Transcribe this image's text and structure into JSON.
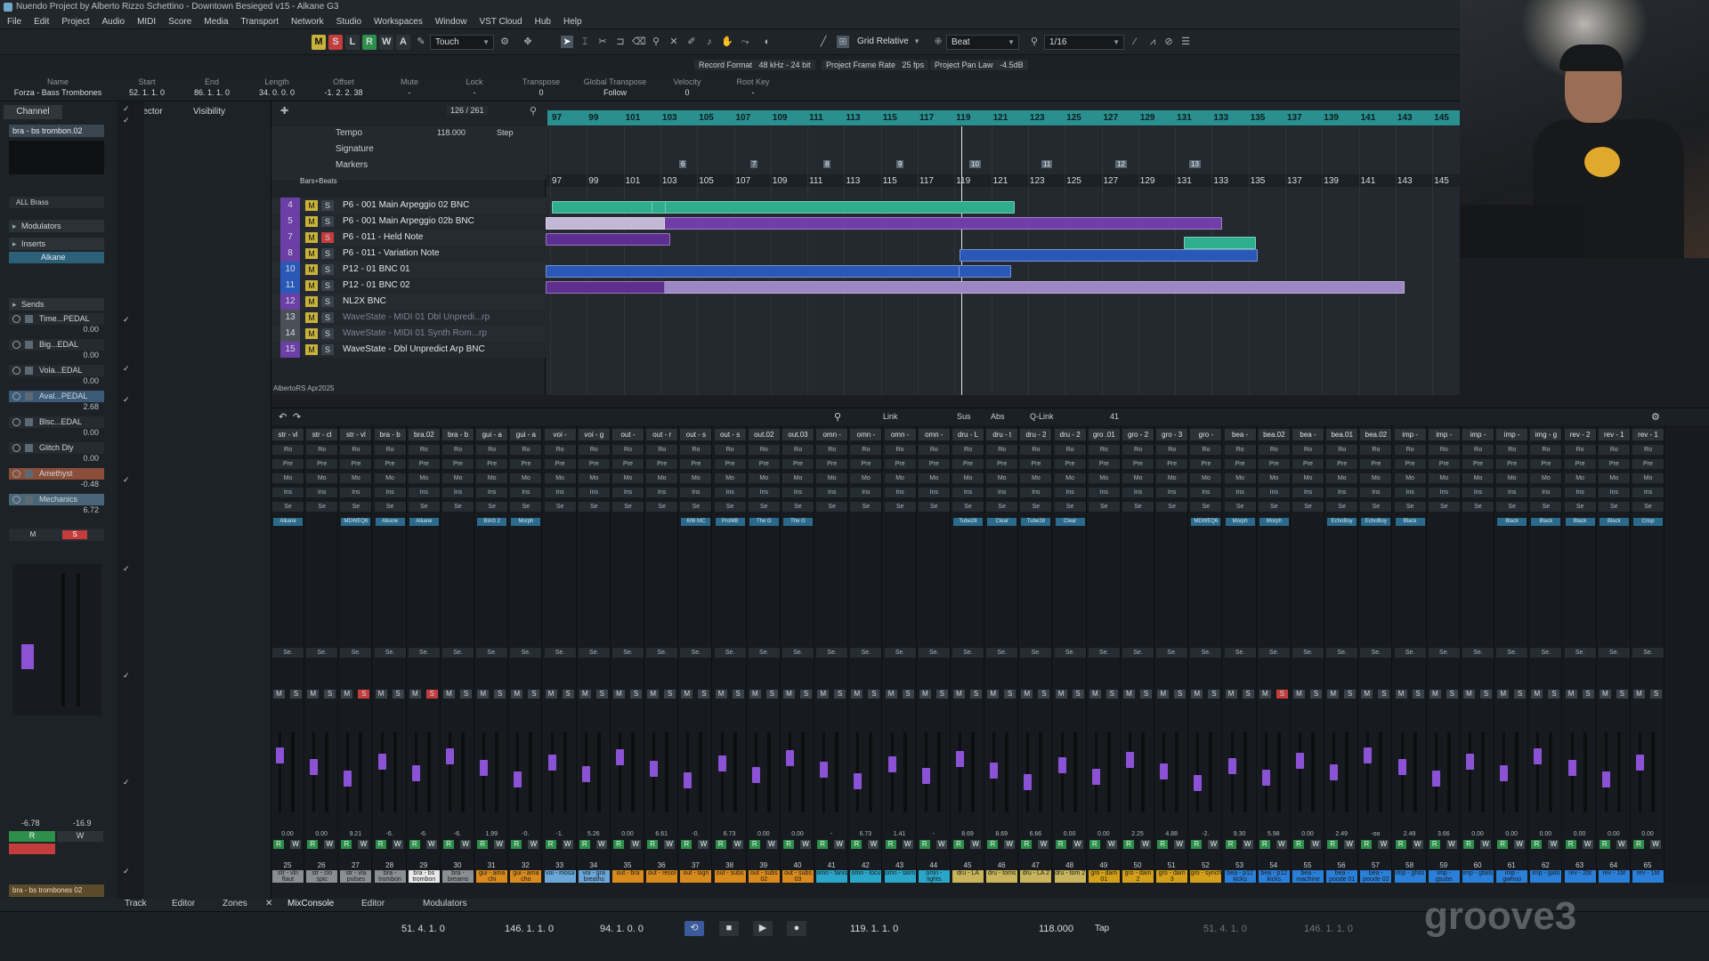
{
  "window": {
    "title": "Nuendo Project by Alberto Rizzo Schettino - Downtown Besieged v15 - Alkane G3"
  },
  "menu": [
    "File",
    "Edit",
    "Project",
    "Audio",
    "MIDI",
    "Score",
    "Media",
    "Transport",
    "Network",
    "Studio",
    "Workspaces",
    "Window",
    "VST Cloud",
    "Hub",
    "Help"
  ],
  "toolbar": {
    "buttons": [
      "M",
      "S",
      "L",
      "R",
      "W",
      "A"
    ],
    "automation_mode": "Touch",
    "grid_mode": "Grid Relative",
    "grid_type": "Beat",
    "quantize": "1/16"
  },
  "status": {
    "record_format_label": "Record Format",
    "record_format": "48 kHz - 24 bit",
    "frame_rate_label": "Project Frame Rate",
    "frame_rate": "25 fps",
    "pan_law_label": "Project Pan Law",
    "pan_law": "-4.5dB"
  },
  "infoline": {
    "labels": [
      "Name",
      "Start",
      "End",
      "Length",
      "Offset",
      "Mute",
      "Lock",
      "Transpose",
      "Global Transpose",
      "Velocity",
      "Root Key"
    ],
    "values": [
      "Forza - Bass Trombones",
      "52. 1. 1. 0",
      "86. 1. 1. 0",
      "34. 0. 0. 0",
      "-1. 2. 2. 38",
      "-",
      "-",
      "0",
      "Follow",
      "0",
      "-"
    ]
  },
  "leftzone": {
    "tabs": [
      "Channel",
      "Inspector",
      "Visibility"
    ],
    "channel_name": "bra - bs trombon.02",
    "filter": "ALL Brass",
    "sections": {
      "modulators": "Modulators",
      "inserts": "Inserts",
      "sends": "Sends"
    },
    "insert": "Alkane",
    "sends": [
      {
        "name": "Time...PEDAL",
        "value": "0.00"
      },
      {
        "name": "Big...EDAL",
        "value": "0.00"
      },
      {
        "name": "Vola...EDAL",
        "value": "0.00"
      },
      {
        "name": "Aval...PEDAL",
        "value": "2.68"
      },
      {
        "name": "Blsc...EDAL",
        "value": "0.00"
      },
      {
        "name": "Glitch Dly",
        "value": "0.00"
      },
      {
        "name": "Amethyst",
        "value": "-0.48"
      },
      {
        "name": "Mechanics",
        "value": "6.72"
      }
    ],
    "meter_values": [
      "-6.78",
      "-16.9"
    ],
    "bottom_name": "bra - bs trombones 02"
  },
  "ruler": {
    "bars": [
      "97",
      "99",
      "101",
      "103",
      "105",
      "107",
      "109",
      "111",
      "113",
      "115",
      "117",
      "119",
      "121",
      "123",
      "125",
      "127",
      "129",
      "131",
      "133",
      "135",
      "137",
      "139",
      "141",
      "143",
      "145"
    ],
    "track_count": "126 / 261"
  },
  "global_tracks": [
    {
      "name": "Tempo",
      "value": "118.000",
      "mode": "Step"
    },
    {
      "name": "Signature"
    },
    {
      "name": "Markers"
    },
    {
      "name": "Bars+Beats"
    }
  ],
  "markers": [
    "6",
    "7",
    "8",
    "9",
    "10",
    "11",
    "12",
    "13"
  ],
  "tracks": [
    {
      "num": "4",
      "name": "P6 - 001 Main Arpeggio 02 BNC",
      "mute": false,
      "solo": false
    },
    {
      "num": "5",
      "name": "P6 - 001 Main Arpeggio 02b BNC",
      "mute": false,
      "solo": false
    },
    {
      "num": "7",
      "name": "P6 - 011 - Held Note",
      "mute": false,
      "solo": true
    },
    {
      "num": "8",
      "name": "P6 - 011 - Variation Note",
      "mute": false,
      "solo": false
    },
    {
      "num": "10",
      "name": "P12 - 01 BNC 01",
      "mute": false,
      "solo": false
    },
    {
      "num": "11",
      "name": "P12 - 01 BNC 02",
      "mute": false,
      "solo": false
    },
    {
      "num": "12",
      "name": "NL2X BNC",
      "mute": false,
      "solo": false
    },
    {
      "num": "13",
      "name": "WaveState - MIDI 01 Dbl Unpredi...rp",
      "mute": false,
      "solo": false
    },
    {
      "num": "14",
      "name": "WaveState - MIDI 01 Synth Rom...rp",
      "mute": false,
      "solo": false
    },
    {
      "num": "15",
      "name": "WaveState - Dbl Unpredict Arp BNC",
      "mute": false,
      "solo": false
    }
  ],
  "project_footer": "AlbertoRS Apr2025",
  "mixconsole": {
    "link": "Link",
    "sus": "Sus",
    "abs": "Abs",
    "qlink": "Q-Link",
    "count": "41"
  },
  "channels": [
    {
      "name": "str - vl",
      "num": "25",
      "bname": "str - vln flaut",
      "plug": "Alkane",
      "vol": "0.00",
      "color": "#8a8f93"
    },
    {
      "name": "str - cl",
      "num": "26",
      "bname": "str - clo spic",
      "plug": "",
      "vol": "0.00",
      "color": "#8a8f93"
    },
    {
      "name": "str - vl",
      "num": "27",
      "bname": "str - vla pulses",
      "plug": "MDWEQ6",
      "vol": "9.21",
      "color": "#8a8f93"
    },
    {
      "name": "bra - b",
      "num": "28",
      "bname": "bra - trombon",
      "plug": "Alkane",
      "vol": "-6.",
      "color": "#8a8f93"
    },
    {
      "name": "bra.02",
      "num": "29",
      "bname": "bra - bs trombon",
      "plug": "Alkane",
      "vol": "-6.",
      "color": "#e8e8e8"
    },
    {
      "name": "bra - b",
      "num": "30",
      "bname": "bra - breams",
      "plug": "",
      "vol": "-6.",
      "color": "#8a8f93"
    },
    {
      "name": "gui - a",
      "num": "31",
      "bname": "gui - ama chi",
      "plug": "BIAS 2",
      "vol": "1.99",
      "color": "#d98a1c"
    },
    {
      "name": "gui - a",
      "num": "32",
      "bname": "gui - ama cho",
      "plug": "Morph",
      "vol": "-0.",
      "color": "#d98a1c"
    },
    {
      "name": "voi - ",
      "num": "33",
      "bname": "voi - mosa",
      "plug": "",
      "vol": "-1.",
      "color": "#6aa7d8"
    },
    {
      "name": "voi - g",
      "num": "34",
      "bname": "voi - gra breaths",
      "plug": "",
      "vol": "5.26",
      "color": "#6aa7d8"
    },
    {
      "name": "out - ",
      "num": "35",
      "bname": "out - bra",
      "plug": "",
      "vol": "0.00",
      "color": "#d98a1c"
    },
    {
      "name": "out - r",
      "num": "36",
      "bname": "out - resol",
      "plug": "",
      "vol": "6.61",
      "color": "#d98a1c"
    },
    {
      "name": "out - s",
      "num": "37",
      "bname": "out - sign",
      "plug": "606 MC",
      "vol": "-0.",
      "color": "#d98a1c"
    },
    {
      "name": "out - s",
      "num": "38",
      "bname": "out - subs",
      "plug": "ProMB",
      "vol": "6.73",
      "color": "#d98a1c"
    },
    {
      "name": "out.02",
      "num": "39",
      "bname": "out - subs 02",
      "plug": "The G",
      "vol": "0.00",
      "color": "#d98a1c"
    },
    {
      "name": "out.03",
      "num": "40",
      "bname": "out - subs 03",
      "plug": "The G",
      "vol": "0.00",
      "color": "#d98a1c"
    },
    {
      "name": "omn - ",
      "num": "41",
      "bname": "omn - fanis",
      "plug": "",
      "vol": "-",
      "color": "#2aa6c8"
    },
    {
      "name": "omn - ",
      "num": "42",
      "bname": "omn - locu",
      "plug": "",
      "vol": "6.73",
      "color": "#2aa6c8"
    },
    {
      "name": "omn - ",
      "num": "43",
      "bname": "omn - skim",
      "plug": "",
      "vol": "1.41",
      "color": "#2aa6c8"
    },
    {
      "name": "omn - ",
      "num": "44",
      "bname": "omn - lights",
      "plug": "",
      "vol": "-",
      "color": "#2aa6c8"
    },
    {
      "name": "dru - L",
      "num": "45",
      "bname": "dru - LA",
      "plug": "Tube28",
      "vol": "8.69",
      "color": "#c8b45a"
    },
    {
      "name": "dru - t",
      "num": "46",
      "bname": "dru - toms",
      "plug": "Clear",
      "vol": "8.69",
      "color": "#c8b45a"
    },
    {
      "name": "dru - 2",
      "num": "47",
      "bname": "dru - LA 2",
      "plug": "Tube28",
      "vol": "6.66",
      "color": "#c8b45a"
    },
    {
      "name": "dru - 2",
      "num": "48",
      "bname": "dru - tom 2",
      "plug": "Clear",
      "vol": "0.00",
      "color": "#c8b45a"
    },
    {
      "name": "gro .01",
      "num": "49",
      "bname": "gro - dam 01",
      "plug": "",
      "vol": "0.00",
      "color": "#d4a019"
    },
    {
      "name": "gro - 2",
      "num": "50",
      "bname": "gro - dam 2",
      "plug": "",
      "vol": "2.25",
      "color": "#d4a019"
    },
    {
      "name": "gro - 3",
      "num": "51",
      "bname": "gro - dam 3",
      "plug": "",
      "vol": "4.88",
      "color": "#d4a019"
    },
    {
      "name": "gro - ",
      "num": "52",
      "bname": "gro - synch",
      "plug": "MDWEQ6",
      "vol": "-2.",
      "color": "#d4a019"
    },
    {
      "name": "bea - ",
      "num": "53",
      "bname": "bea - p12 kicks",
      "plug": "Morph",
      "vol": "9.30",
      "color": "#2a7fd8"
    },
    {
      "name": "bea.02",
      "num": "54",
      "bname": "bea - p12 kicks",
      "plug": "Morph",
      "vol": "5.98",
      "color": "#2a7fd8"
    },
    {
      "name": "bea - ",
      "num": "55",
      "bname": "bea - machine",
      "plug": "",
      "vol": "0.00",
      "color": "#2a7fd8"
    },
    {
      "name": "bea.01",
      "num": "56",
      "bname": "bea - poode 01",
      "plug": "EchoBoy",
      "vol": "2.49",
      "color": "#2a7fd8"
    },
    {
      "name": "bea.02",
      "num": "57",
      "bname": "bea - poode 02",
      "plug": "EchoBoy",
      "vol": "-oo",
      "color": "#2a7fd8"
    },
    {
      "name": "imp - ",
      "num": "58",
      "bname": "imp - ghits",
      "plug": "Black",
      "vol": "2.49",
      "color": "#2a7fd8"
    },
    {
      "name": "imp - ",
      "num": "59",
      "bname": "imp - gsubs",
      "plug": "",
      "vol": "3.66",
      "color": "#2a7fd8"
    },
    {
      "name": "imp - ",
      "num": "60",
      "bname": "imp - gtails",
      "plug": "",
      "vol": "0.00",
      "color": "#2a7fd8"
    },
    {
      "name": "imp - ",
      "num": "61",
      "bname": "imp - gwhoo",
      "plug": "Black",
      "vol": "0.00",
      "color": "#2a7fd8"
    },
    {
      "name": "img - g",
      "num": "62",
      "bname": "imp - gato",
      "plug": "Black",
      "vol": "0.00",
      "color": "#2a7fd8"
    },
    {
      "name": "rev - 2",
      "num": "63",
      "bname": "rev - 2bt",
      "plug": "Black",
      "vol": "0.00",
      "color": "#2a7fd8"
    },
    {
      "name": "rev - 1",
      "num": "64",
      "bname": "rev - 1bt",
      "plug": "Black",
      "vol": "0.00",
      "color": "#2a7fd8"
    },
    {
      "name": "rev - 1",
      "num": "65",
      "bname": "rev - 1bt",
      "plug": "Crisp",
      "vol": "0.00",
      "color": "#2a7fd8"
    }
  ],
  "bottomtabs": [
    "Track",
    "Editor",
    "Zones",
    "MixConsole",
    "Editor",
    "Modulators"
  ],
  "transport": {
    "left_locator": "51. 4. 1. 0",
    "right_locator": "146. 1. 1. 0",
    "punch": "94. 1. 0. 0",
    "position": "119. 1. 1. 0",
    "tempo": "118.000",
    "tap": "Tap",
    "pos2": "51. 4. 1. 0",
    "pos3": "146. 1. 1. 0"
  },
  "watermark": "groove3",
  "colors": {
    "accent": "#2a8f8f",
    "fader": "#8c52d6",
    "record": "#c43c3c",
    "monitor": "#2d8f4a"
  }
}
